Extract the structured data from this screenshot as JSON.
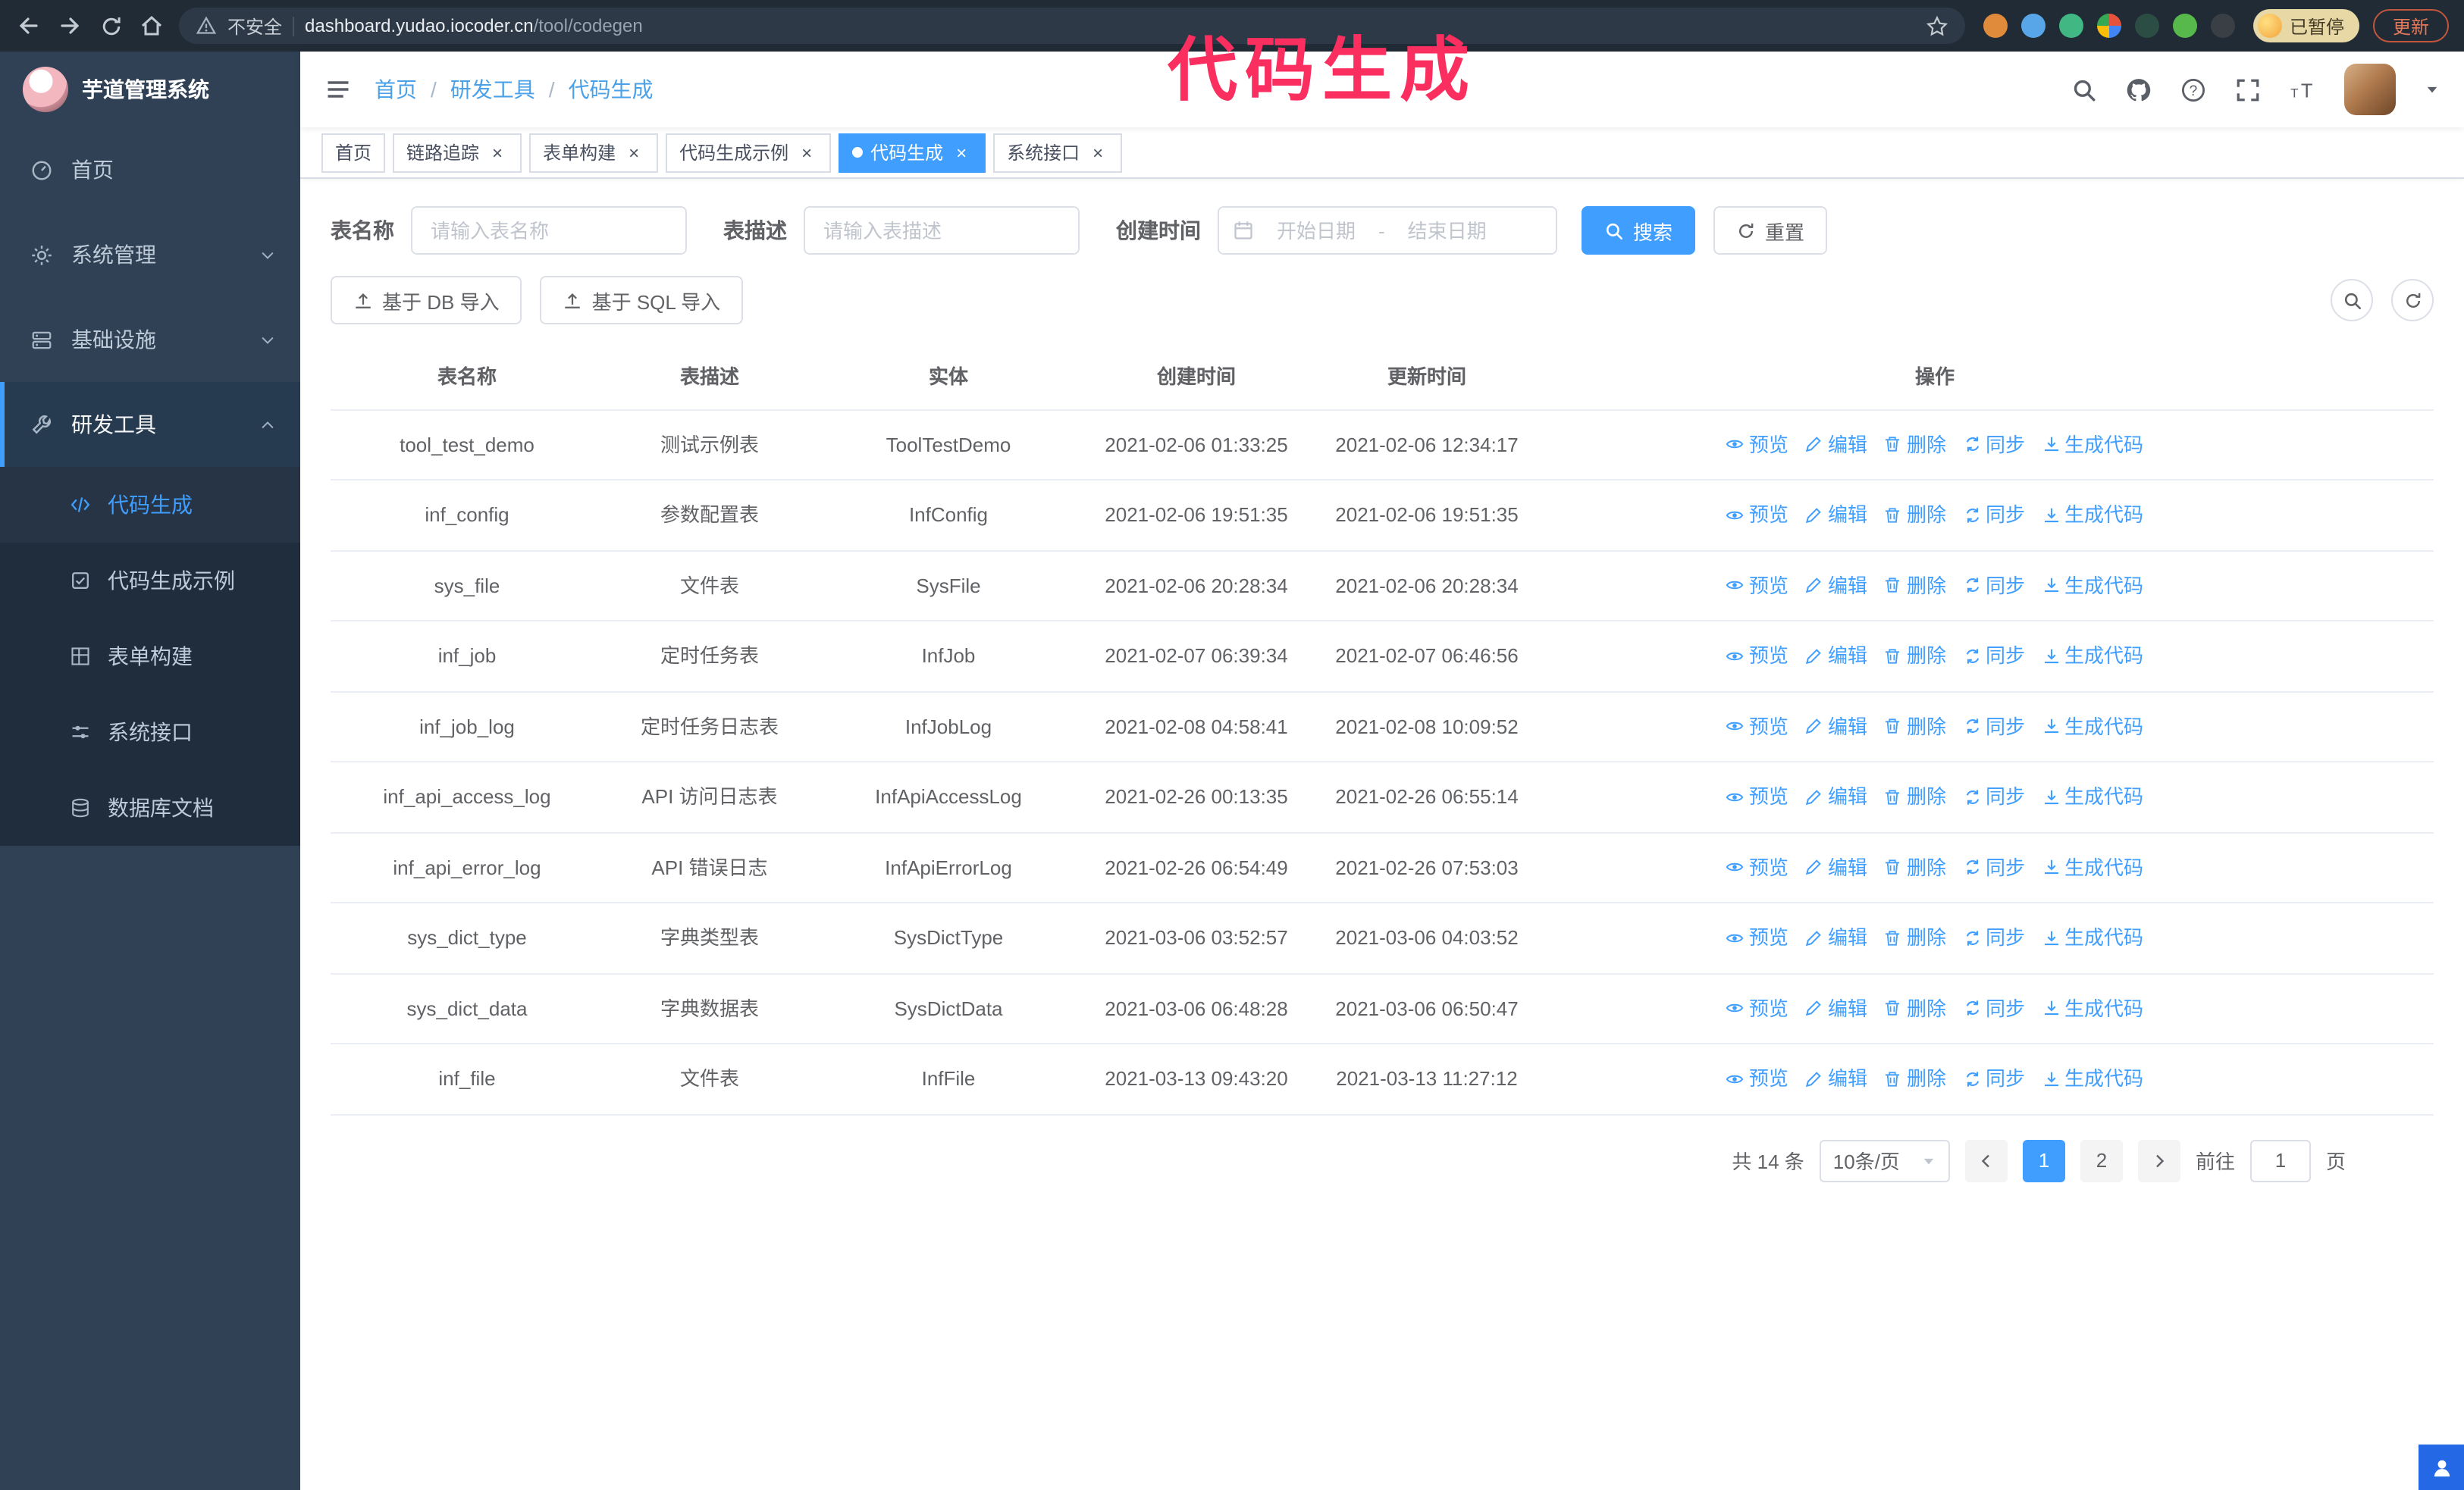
{
  "browser": {
    "security_label": "不安全",
    "url_host": "dashboard.yudao.iocoder.cn",
    "url_path": "/tool/codegen",
    "paused_badge": "已暂停",
    "update_button": "更新"
  },
  "annotation": {
    "text": "代码生成"
  },
  "sidebar": {
    "logo_title": "芋道管理系统",
    "items": [
      {
        "label": "首页"
      },
      {
        "label": "系统管理"
      },
      {
        "label": "基础设施"
      },
      {
        "label": "研发工具"
      }
    ],
    "sub_items": [
      {
        "label": "代码生成"
      },
      {
        "label": "代码生成示例"
      },
      {
        "label": "表单构建"
      },
      {
        "label": "系统接口"
      },
      {
        "label": "数据库文档"
      }
    ]
  },
  "breadcrumb": {
    "items": [
      "首页",
      "研发工具",
      "代码生成"
    ],
    "separator": "/"
  },
  "tags": [
    {
      "label": "首页"
    },
    {
      "label": "链路追踪"
    },
    {
      "label": "表单构建"
    },
    {
      "label": "代码生成示例"
    },
    {
      "label": "代码生成"
    },
    {
      "label": "系统接口"
    }
  ],
  "filters": {
    "table_name_label": "表名称",
    "table_name_placeholder": "请输入表名称",
    "table_desc_label": "表描述",
    "table_desc_placeholder": "请输入表描述",
    "create_time_label": "创建时间",
    "date_start_placeholder": "开始日期",
    "date_separator": "-",
    "date_end_placeholder": "结束日期",
    "search_label": "搜索",
    "reset_label": "重置"
  },
  "toolbar": {
    "import_db_label": "基于 DB 导入",
    "import_sql_label": "基于 SQL 导入"
  },
  "table": {
    "columns": [
      "表名称",
      "表描述",
      "实体",
      "创建时间",
      "更新时间",
      "操作"
    ],
    "actions": [
      "预览",
      "编辑",
      "删除",
      "同步",
      "生成代码"
    ],
    "rows": [
      {
        "name": "tool_test_demo",
        "desc": "测试示例表",
        "entity": "ToolTestDemo",
        "created": "2021-02-06 01:33:25",
        "updated": "2021-02-06 12:34:17"
      },
      {
        "name": "inf_config",
        "desc": "参数配置表",
        "entity": "InfConfig",
        "created": "2021-02-06 19:51:35",
        "updated": "2021-02-06 19:51:35"
      },
      {
        "name": "sys_file",
        "desc": "文件表",
        "entity": "SysFile",
        "created": "2021-02-06 20:28:34",
        "updated": "2021-02-06 20:28:34"
      },
      {
        "name": "inf_job",
        "desc": "定时任务表",
        "entity": "InfJob",
        "created": "2021-02-07 06:39:34",
        "updated": "2021-02-07 06:46:56"
      },
      {
        "name": "inf_job_log",
        "desc": "定时任务日志表",
        "entity": "InfJobLog",
        "created": "2021-02-08 04:58:41",
        "updated": "2021-02-08 10:09:52"
      },
      {
        "name": "inf_api_access_log",
        "desc": "API 访问日志表",
        "entity": "InfApiAccessLog",
        "created": "2021-02-26 00:13:35",
        "updated": "2021-02-26 06:55:14"
      },
      {
        "name": "inf_api_error_log",
        "desc": "API 错误日志",
        "entity": "InfApiErrorLog",
        "created": "2021-02-26 06:54:49",
        "updated": "2021-02-26 07:53:03"
      },
      {
        "name": "sys_dict_type",
        "desc": "字典类型表",
        "entity": "SysDictType",
        "created": "2021-03-06 03:52:57",
        "updated": "2021-03-06 04:03:52"
      },
      {
        "name": "sys_dict_data",
        "desc": "字典数据表",
        "entity": "SysDictData",
        "created": "2021-03-06 06:48:28",
        "updated": "2021-03-06 06:50:47"
      },
      {
        "name": "inf_file",
        "desc": "文件表",
        "entity": "InfFile",
        "created": "2021-03-13 09:43:20",
        "updated": "2021-03-13 11:27:12"
      }
    ]
  },
  "pagination": {
    "total_label": "共 14 条",
    "page_size_label": "10条/页",
    "pages": [
      "1",
      "2"
    ],
    "goto_label": "前往",
    "goto_value": "1",
    "unit_label": "页"
  },
  "colors": {
    "accent": "#409eff",
    "sidebar_bg": "#304156",
    "annotation": "#fa2e5f"
  }
}
